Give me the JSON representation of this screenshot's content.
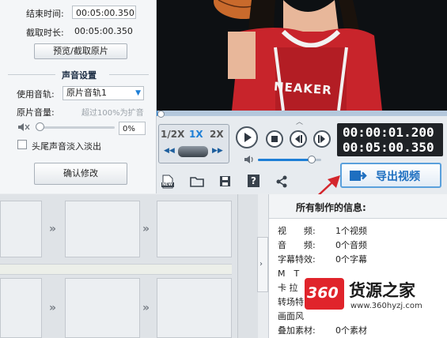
{
  "settings": {
    "end_time_label": "结束时间:",
    "end_time_value": "00:05:00.350",
    "duration_label": "截取时长:",
    "duration_value": "00:05:00.350",
    "preview_button": "预览/截取原片",
    "audio_section_title": "声音设置",
    "audio_track_label": "使用音轨:",
    "audio_track_value": "原片音轨1",
    "volume_label": "原片音量:",
    "volume_hint": "超过100%为扩音",
    "volume_value": "0%",
    "volume_level": 0.0,
    "fade_checkbox_label": "头尾声音淡入淡出",
    "fade_checked": false,
    "confirm_button": "确认修改"
  },
  "player": {
    "speed_options": [
      "1/2X",
      "1X",
      "2X"
    ],
    "speed_selected": "1X",
    "current_time": "00:00:01.200",
    "total_time": "00:05:00.350",
    "progress": 0.004,
    "volume_level": 0.85,
    "video_caption": "NEAKER",
    "export_button": "导出视频"
  },
  "toolbar": {
    "icons": [
      "new-project-icon",
      "open-folder-icon",
      "save-icon",
      "help-icon",
      "share-icon"
    ],
    "new_label": "NEW",
    "help_label": "?"
  },
  "info": {
    "title": "所有制作的信息:",
    "rows": [
      {
        "label": "视　　频:",
        "value": "1个视频"
      },
      {
        "label": "音　　频:",
        "value": "0个音频"
      },
      {
        "label": "字幕特效:",
        "value": "0个字幕"
      },
      {
        "label": "M　T",
        "value": ""
      },
      {
        "label": "卡 拉",
        "value": ""
      },
      {
        "label": "转场特",
        "value": ""
      },
      {
        "label": "画面风",
        "value": ""
      },
      {
        "label": "叠加素材:",
        "value": "0个素材"
      }
    ]
  },
  "watermark": {
    "logo_text": "360",
    "brand": "货源之家",
    "url": "www.360hyzj.com"
  },
  "colors": {
    "accent_blue": "#1e7fd6",
    "time_bg": "#1f2226",
    "export_text": "#1e6fc0",
    "logo_red": "#e0242b"
  }
}
